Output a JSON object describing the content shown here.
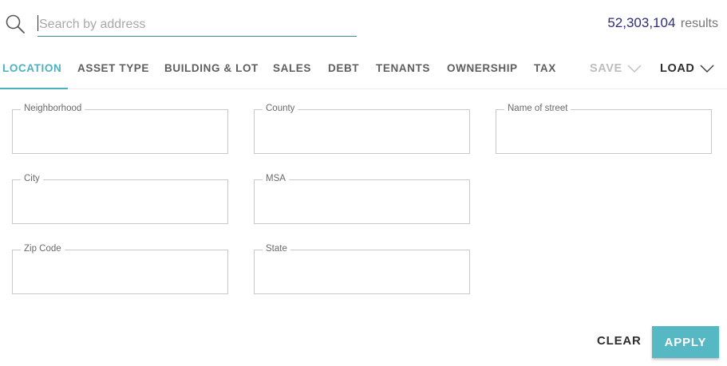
{
  "search": {
    "placeholder": "Search by address",
    "value": "",
    "icon": "search-icon"
  },
  "results": {
    "count": "52,303,104",
    "label": "results"
  },
  "tabs": [
    {
      "label": "LOCATION",
      "active": true
    },
    {
      "label": "ASSET TYPE",
      "active": false
    },
    {
      "label": "BUILDING & LOT",
      "active": false
    },
    {
      "label": "SALES",
      "active": false
    },
    {
      "label": "DEBT",
      "active": false
    },
    {
      "label": "TENANTS",
      "active": false
    },
    {
      "label": "OWNERSHIP",
      "active": false
    },
    {
      "label": "TAX",
      "active": false
    }
  ],
  "actions": {
    "save_label": "SAVE",
    "load_label": "LOAD"
  },
  "fields": {
    "neighborhood": {
      "label": "Neighborhood",
      "value": ""
    },
    "county": {
      "label": "County",
      "value": ""
    },
    "name_of_street": {
      "label": "Name of street",
      "value": ""
    },
    "city": {
      "label": "City",
      "value": ""
    },
    "msa": {
      "label": "MSA",
      "value": ""
    },
    "zip_code": {
      "label": "Zip Code",
      "value": ""
    },
    "state": {
      "label": "State",
      "value": ""
    }
  },
  "buttons": {
    "clear_label": "CLEAR",
    "apply_label": "APPLY"
  },
  "colors": {
    "accent": "#4db1bd",
    "apply_bg": "#55b8c3",
    "results_count": "#2d2d7a",
    "search_underline": "#3a8e8c",
    "save_disabled": "#bdbdbd"
  }
}
